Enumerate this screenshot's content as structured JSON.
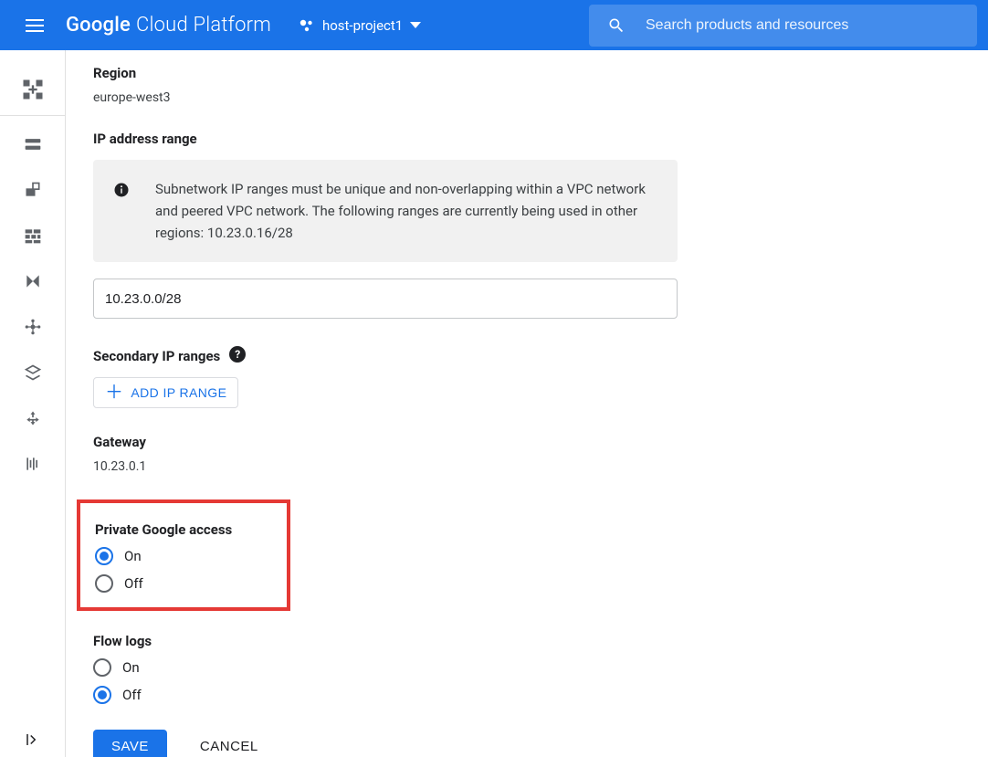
{
  "header": {
    "brand_google": "Google",
    "brand_rest": "Cloud Platform",
    "project_name": "host-project1",
    "search_placeholder": "Search products and resources"
  },
  "leftnav": {
    "items": [
      "vpc-network-icon",
      "ip-addresses-icon",
      "byoip-icon",
      "firewall-icon",
      "routes-icon",
      "peering-icon",
      "shared-vpc-icon",
      "serverless-vpc-icon",
      "packet-mirroring-icon"
    ]
  },
  "form": {
    "region_label": "Region",
    "region_value": "europe-west3",
    "ip_range_label": "IP address range",
    "ip_range_info": "Subnetwork IP ranges must be unique and non-overlapping within a VPC network and peered VPC network. The following ranges are currently being used in other regions: 10.23.0.16/28",
    "ip_range_value": "10.23.0.0/28",
    "secondary_label": "Secondary IP ranges",
    "add_ip_range_button": "ADD IP RANGE",
    "gateway_label": "Gateway",
    "gateway_value": "10.23.0.1",
    "pga_label": "Private Google access",
    "pga_options": {
      "on": "On",
      "off": "Off"
    },
    "pga_value": "on",
    "flowlogs_label": "Flow logs",
    "flowlogs_options": {
      "on": "On",
      "off": "Off"
    },
    "flowlogs_value": "off",
    "save_button": "SAVE",
    "cancel_button": "CANCEL"
  }
}
